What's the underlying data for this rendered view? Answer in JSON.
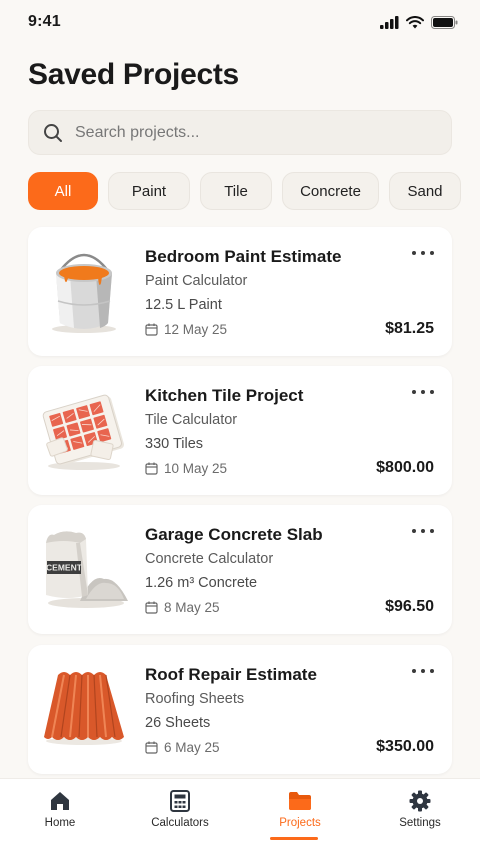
{
  "status_bar": {
    "time": "9:41"
  },
  "page": {
    "title": "Saved Projects"
  },
  "search": {
    "placeholder": "Search projects..."
  },
  "filters": [
    {
      "label": "All",
      "active": true
    },
    {
      "label": "Paint",
      "active": false
    },
    {
      "label": "Tile",
      "active": false
    },
    {
      "label": "Concrete",
      "active": false
    },
    {
      "label": "Sand",
      "active": false
    }
  ],
  "projects": [
    {
      "title": "Bedroom Paint Estimate",
      "calculator": "Paint Calculator",
      "quantity": "12.5 L Paint",
      "date": "12 May 25",
      "price": "$81.25",
      "image": "paint-bucket"
    },
    {
      "title": "Kitchen Tile Project",
      "calculator": "Tile Calculator",
      "quantity": "330 Tiles",
      "date": "10 May 25",
      "price": "$800.00",
      "image": "tiles"
    },
    {
      "title": "Garage Concrete Slab",
      "calculator": "Concrete Calculator",
      "quantity": "1.26 m³ Concrete",
      "date": "8 May 25",
      "price": "$96.50",
      "image": "cement-bag",
      "image_text": "CEMENT"
    },
    {
      "title": "Roof Repair Estimate",
      "calculator": "Roofing Sheets",
      "quantity": "26 Sheets",
      "date": "6 May 25",
      "price": "$350.00",
      "image": "roofing-sheet"
    }
  ],
  "tabbar": {
    "items": [
      {
        "label": "Home",
        "icon": "home-icon"
      },
      {
        "label": "Calculators",
        "icon": "calculator-icon"
      },
      {
        "label": "Projects",
        "icon": "folder-icon",
        "active": true
      },
      {
        "label": "Settings",
        "icon": "gear-icon"
      }
    ]
  },
  "colors": {
    "accent": "#fc6a1a",
    "background": "#faf8f5",
    "card": "#ffffff"
  }
}
